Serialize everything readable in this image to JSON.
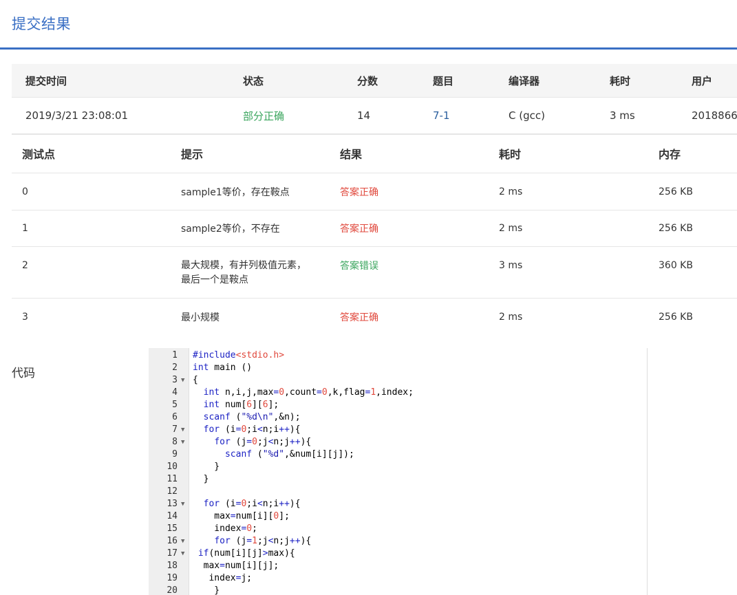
{
  "title": "提交结果",
  "submission": {
    "headers": [
      "提交时间",
      "状态",
      "分数",
      "题目",
      "编译器",
      "耗时",
      "用户"
    ],
    "row": {
      "time": "2019/3/21 23:08:01",
      "status": "部分正确",
      "score": "14",
      "problem": "7-1",
      "compiler": "C (gcc)",
      "duration": "3 ms",
      "user": "2018866"
    }
  },
  "tests": {
    "headers": [
      "测试点",
      "提示",
      "结果",
      "耗时",
      "内存"
    ],
    "rows": [
      {
        "id": "0",
        "hint": "sample1等价，存在鞍点",
        "result": "答案正确",
        "time": "2 ms",
        "memory": "256 KB"
      },
      {
        "id": "1",
        "hint": "sample2等价，不存在",
        "result": "答案正确",
        "time": "2 ms",
        "memory": "256 KB"
      },
      {
        "id": "2",
        "hint": "最大规模，有并列极值元素，最后一个是鞍点",
        "hint_lines": [
          "最大规模，有并列极值元素，",
          "最后一个是鞍点"
        ],
        "result": "答案错误",
        "time": "3 ms",
        "memory": "360 KB"
      },
      {
        "id": "3",
        "hint": "最小规模",
        "result": "答案正确",
        "time": "2 ms",
        "memory": "256 KB"
      }
    ]
  },
  "code": {
    "label": "代码",
    "lines": [
      {
        "n": "1",
        "fold": false,
        "text": "#include<stdio.h>"
      },
      {
        "n": "2",
        "fold": false,
        "text": "int main ()"
      },
      {
        "n": "3",
        "fold": true,
        "text": "{"
      },
      {
        "n": "4",
        "fold": false,
        "text": "  int n,i,j,max=0,count=0,k,flag=1,index;"
      },
      {
        "n": "5",
        "fold": false,
        "text": "  int num[6][6];"
      },
      {
        "n": "6",
        "fold": false,
        "text": "  scanf (\"%d\\n\",&n);"
      },
      {
        "n": "7",
        "fold": true,
        "text": "  for (i=0;i<n;i++){"
      },
      {
        "n": "8",
        "fold": true,
        "text": "    for (j=0;j<n;j++){"
      },
      {
        "n": "9",
        "fold": false,
        "text": "      scanf (\"%d\",&num[i][j]);"
      },
      {
        "n": "10",
        "fold": false,
        "text": "    }"
      },
      {
        "n": "11",
        "fold": false,
        "text": "  }"
      },
      {
        "n": "12",
        "fold": false,
        "text": ""
      },
      {
        "n": "13",
        "fold": true,
        "text": "  for (i=0;i<n;i++){"
      },
      {
        "n": "14",
        "fold": false,
        "text": "    max=num[i][0];"
      },
      {
        "n": "15",
        "fold": false,
        "text": "    index=0;"
      },
      {
        "n": "16",
        "fold": true,
        "text": "    for (j=1;j<n;j++){"
      },
      {
        "n": "17",
        "fold": true,
        "text": " if(num[i][j]>max){"
      },
      {
        "n": "18",
        "fold": false,
        "text": "  max=num[i][j];"
      },
      {
        "n": "19",
        "fold": false,
        "text": "   index=j;"
      },
      {
        "n": "20",
        "fold": false,
        "text": "    }"
      }
    ]
  },
  "colors": {
    "accent": "#3a6fc4",
    "success": "#3aa55d",
    "error": "#e0483c",
    "link": "#2b5f9e"
  }
}
